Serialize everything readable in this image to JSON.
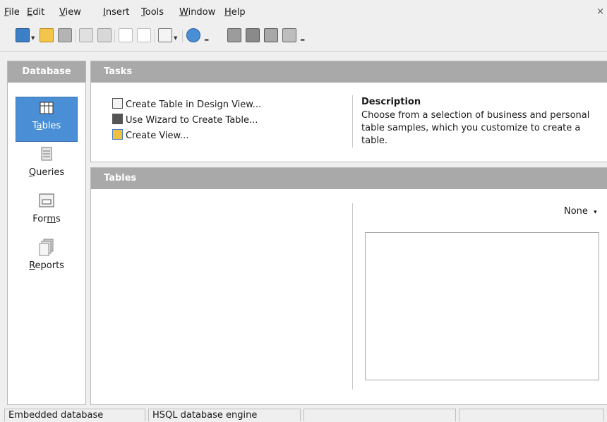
{
  "menubar": {
    "items": [
      {
        "pre": "",
        "u": "F",
        "post": "ile"
      },
      {
        "pre": "",
        "u": "E",
        "post": "dit"
      },
      {
        "pre": "",
        "u": "V",
        "post": "iew"
      },
      {
        "pre": "",
        "u": "I",
        "post": "nsert"
      },
      {
        "pre": "",
        "u": "T",
        "post": "ools"
      },
      {
        "pre": "",
        "u": "W",
        "post": "indow"
      },
      {
        "pre": "",
        "u": "H",
        "post": "elp"
      }
    ],
    "close_glyph": "×"
  },
  "toolbar": {
    "icons": [
      "new-document-icon",
      "open-folder-icon",
      "save-icon",
      "copy-icon",
      "paste-icon",
      "sort-ascending-icon",
      "sort-descending-icon",
      "form-icon",
      "help-icon",
      "table-icon",
      "edit-icon",
      "delete-icon",
      "form-design-icon"
    ]
  },
  "left_panel": {
    "title": "Database",
    "categories": [
      {
        "pre": "T",
        "u": "a",
        "post": "bles"
      },
      {
        "pre": "",
        "u": "Q",
        "post": "ueries"
      },
      {
        "pre": "For",
        "u": "m",
        "post": "s"
      },
      {
        "pre": "",
        "u": "R",
        "post": "eports"
      }
    ],
    "selected": "Tables"
  },
  "tasks_panel": {
    "title": "Tasks",
    "tasks": [
      "Create Table in Design View...",
      "Use Wizard to Create Table...",
      "Create View..."
    ],
    "description_title": "Description",
    "description_text": "Choose from a selection of business and personal table samples, which you customize to create a table."
  },
  "tables_panel": {
    "title": "Tables",
    "preview_mode": "None",
    "preview_arrow": "▾"
  },
  "statusbar": {
    "cells": [
      "Embedded database",
      "HSQL database engine",
      "",
      ""
    ]
  },
  "colors": {
    "header_bg": "#a9a9a9",
    "selection_bg": "#4a8fd6"
  }
}
